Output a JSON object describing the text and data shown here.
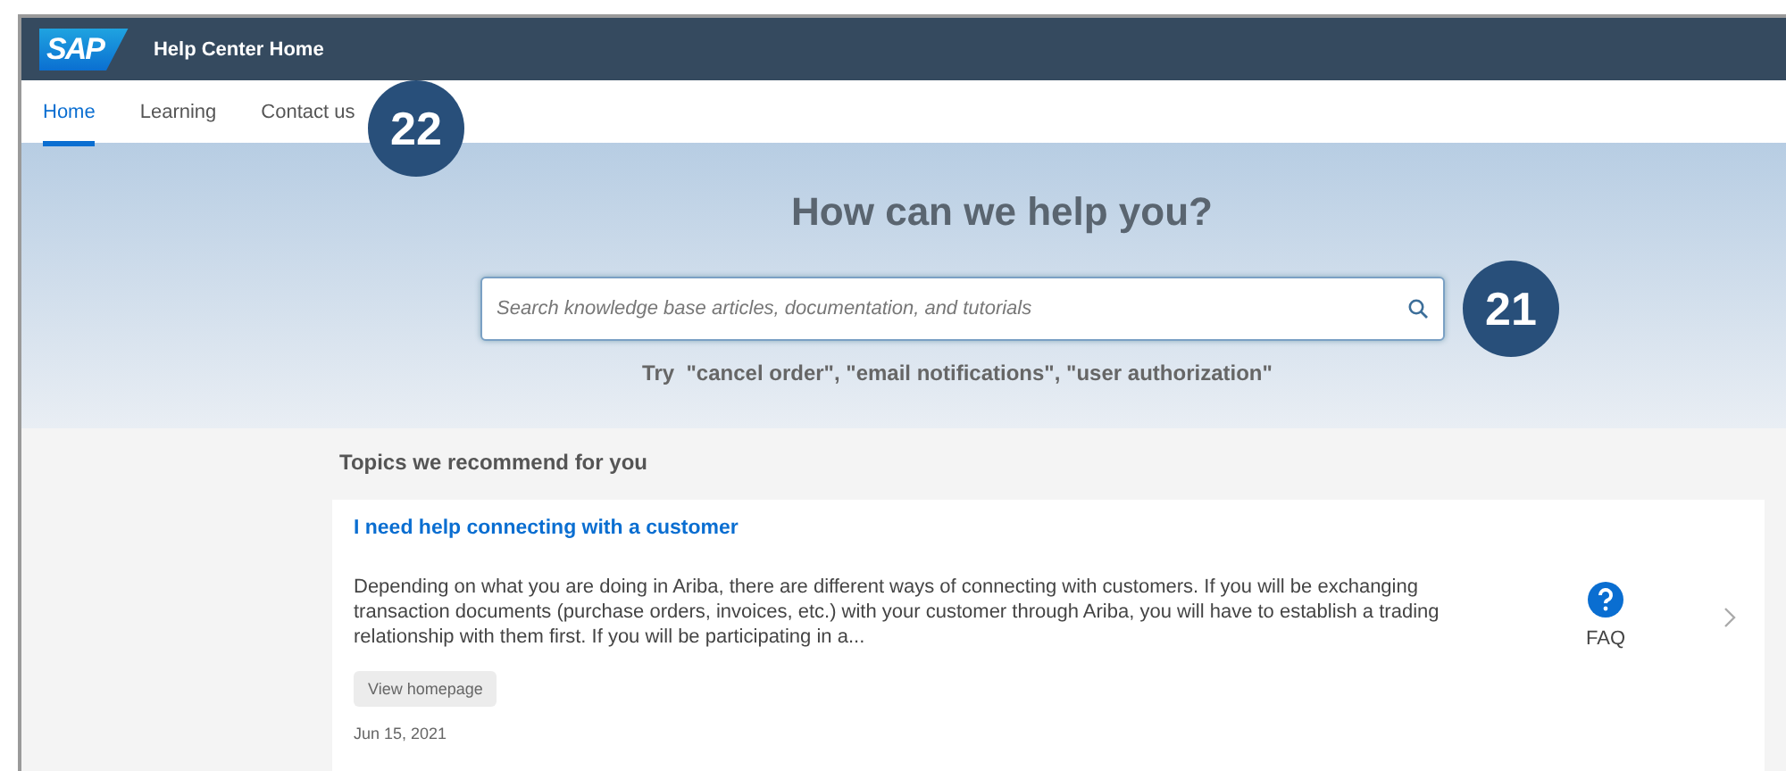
{
  "header": {
    "logo": "SAP",
    "title": "Help Center Home"
  },
  "tabs": [
    {
      "label": "Home",
      "selected": true
    },
    {
      "label": "Learning",
      "selected": false
    },
    {
      "label": "Contact us",
      "selected": false
    }
  ],
  "callouts": [
    {
      "label": "22"
    },
    {
      "label": "21"
    }
  ],
  "hero": {
    "heading": "How can we help you?",
    "search": {
      "placeholder": "Search knowledge base articles, documentation, and tutorials"
    },
    "suggestion": "Try  \"cancel order\", \"email notifications\", \"user authorization\""
  },
  "section_title": "Topics we recommend for you",
  "cards": [
    {
      "title": "I need help connecting with a customer",
      "description": "Depending on what you are doing in Ariba, there are different ways of connecting with customers. If you will be exchanging transaction documents (purchase orders, invoices, etc.) with your customer through Ariba, you will have to establish a trading relationship with them first. If you will be participating in a...",
      "type": "FAQ",
      "button": "View homepage",
      "date": "Jun 15, 2021"
    }
  ]
}
